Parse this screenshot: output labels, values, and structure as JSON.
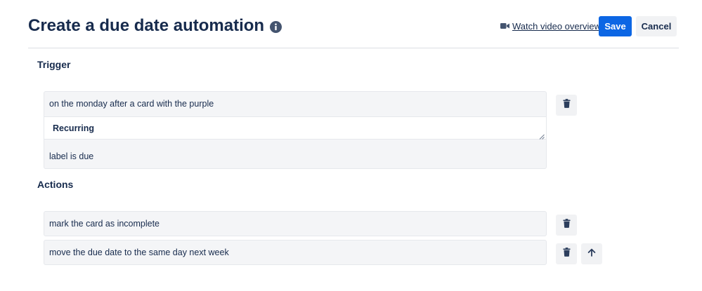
{
  "header": {
    "title": "Create a due date automation",
    "info_icon": "info-circle-icon",
    "video_link": {
      "icon": "video-camera-icon",
      "label": "Watch video overview"
    },
    "save_label": "Save",
    "cancel_label": "Cancel"
  },
  "colors": {
    "primary": "#0c66e4",
    "text": "#172b4d",
    "row_background": "#f4f5f7",
    "neutral_button": "#f1f2f4"
  },
  "trigger": {
    "heading": "Trigger",
    "line_before": "on the monday after a card with the purple",
    "select_value": "Recurring",
    "line_after": "label is due",
    "delete_icon": "trash-icon"
  },
  "actions": {
    "heading": "Actions",
    "items": [
      {
        "text": "mark the card as incomplete",
        "buttons": [
          "trash-icon"
        ]
      },
      {
        "text": "move the due date to the same day next week",
        "buttons": [
          "trash-icon",
          "arrow-up-icon"
        ]
      }
    ]
  }
}
